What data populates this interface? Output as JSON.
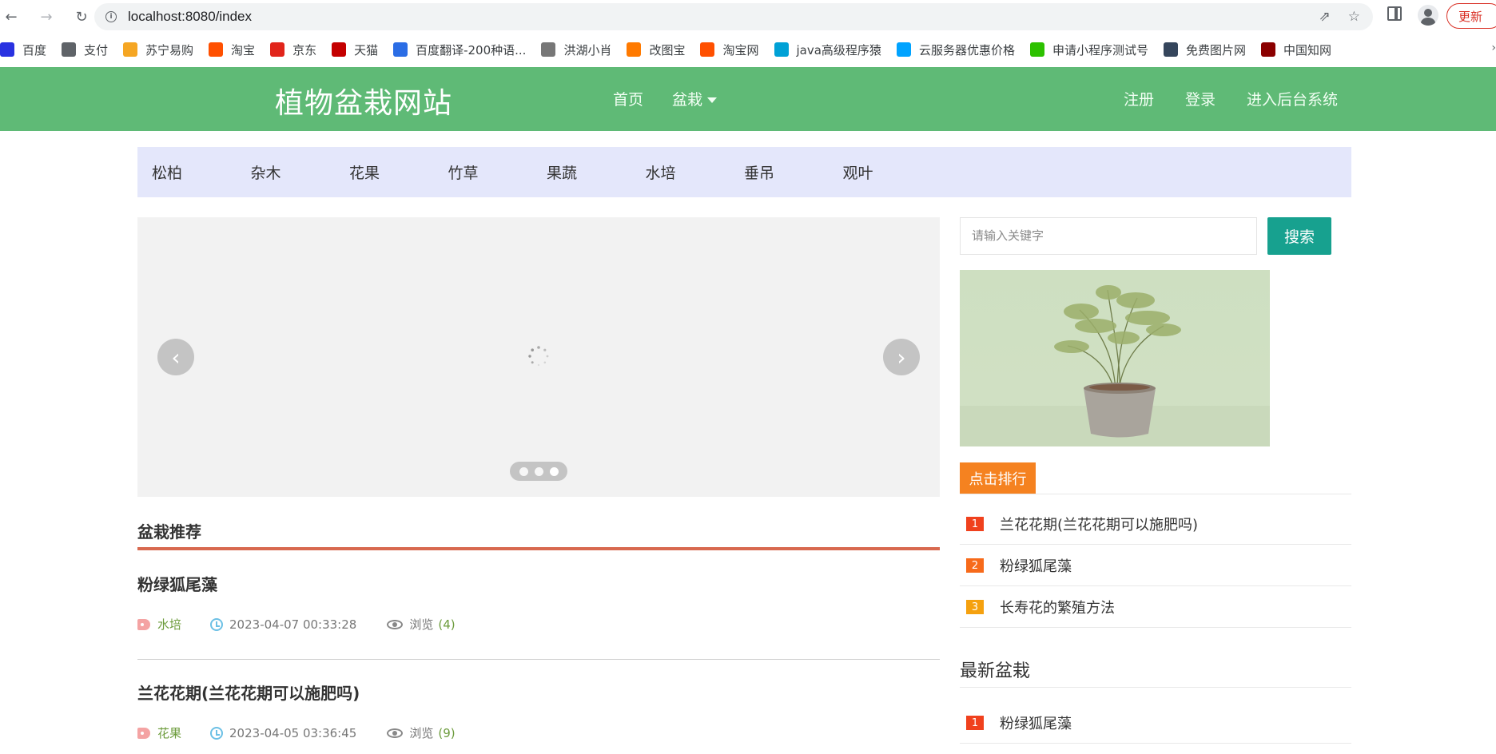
{
  "browser": {
    "url_host": "localhost",
    "url_rest": ":8080/index",
    "update_label": "更新"
  },
  "bookmarks": [
    {
      "label": "百度",
      "icon": "baidu-icon",
      "color": "#2932e1"
    },
    {
      "label": "支付",
      "icon": "globe-icon",
      "color": "#5f6368"
    },
    {
      "label": "苏宁易购",
      "icon": "suning-icon",
      "color": "#f5a623"
    },
    {
      "label": "淘宝",
      "icon": "taobao-icon",
      "color": "#ff5000"
    },
    {
      "label": "京东",
      "icon": "jd-icon",
      "color": "#e1251b"
    },
    {
      "label": "天猫",
      "icon": "tmall-icon",
      "color": "#c40000"
    },
    {
      "label": "百度翻译-200种语...",
      "icon": "translate-icon",
      "color": "#2b6de5"
    },
    {
      "label": "洪湖小肖",
      "icon": "bird-icon",
      "color": "#777777"
    },
    {
      "label": "改图宝",
      "icon": "gaitubao-icon",
      "color": "#ff7a00"
    },
    {
      "label": "淘宝网",
      "icon": "taobao-icon",
      "color": "#ff5000"
    },
    {
      "label": "java高级程序猿",
      "icon": "bilibili-icon",
      "color": "#00a1d6"
    },
    {
      "label": "云服务器优惠价格",
      "icon": "cloud-icon",
      "color": "#00a3ff"
    },
    {
      "label": "申请小程序测试号",
      "icon": "wechat-icon",
      "color": "#2dc100"
    },
    {
      "label": "免费图片网",
      "icon": "tumblr-icon",
      "color": "#35465c"
    },
    {
      "label": "中国知网",
      "icon": "cnki-icon",
      "color": "#8b0000"
    }
  ],
  "header": {
    "logo": "植物盆栽网站",
    "nav_home": "首页",
    "nav_bonsai": "盆栽",
    "register": "注册",
    "login": "登录",
    "admin": "进入后台系统"
  },
  "categories": [
    "松柏",
    "杂木",
    "花果",
    "竹草",
    "果蔬",
    "水培",
    "垂吊",
    "观叶"
  ],
  "search": {
    "placeholder": "请输入关键字",
    "button": "搜索"
  },
  "recommend": {
    "title": "盆栽推荐",
    "views_label": "浏览",
    "items": [
      {
        "title": "粉绿狐尾藻",
        "category": "水培",
        "date": "2023-04-07 00:33:28",
        "views": "(4)"
      },
      {
        "title": "兰花花期(兰花花期可以施肥吗)",
        "category": "花果",
        "date": "2023-04-05 03:36:45",
        "views": "(9)"
      }
    ]
  },
  "ranking": {
    "tab": "点击排行",
    "items": [
      {
        "rank": "1",
        "text": "兰花花期(兰花花期可以施肥吗)",
        "color": "#f0411d"
      },
      {
        "rank": "2",
        "text": "粉绿狐尾藻",
        "color": "#f76a1a"
      },
      {
        "rank": "3",
        "text": "长寿花的繁殖方法",
        "color": "#f5a10f"
      }
    ]
  },
  "latest": {
    "title": "最新盆栽",
    "items": [
      {
        "rank": "1",
        "text": "粉绿狐尾藻",
        "color": "#f0411d"
      }
    ]
  },
  "colors": {
    "header_green": "#5fba76",
    "category_bg": "#e4e7fb",
    "search_button": "#17a18f",
    "rank_tab": "#f58220",
    "section_line": "#d8694f"
  }
}
